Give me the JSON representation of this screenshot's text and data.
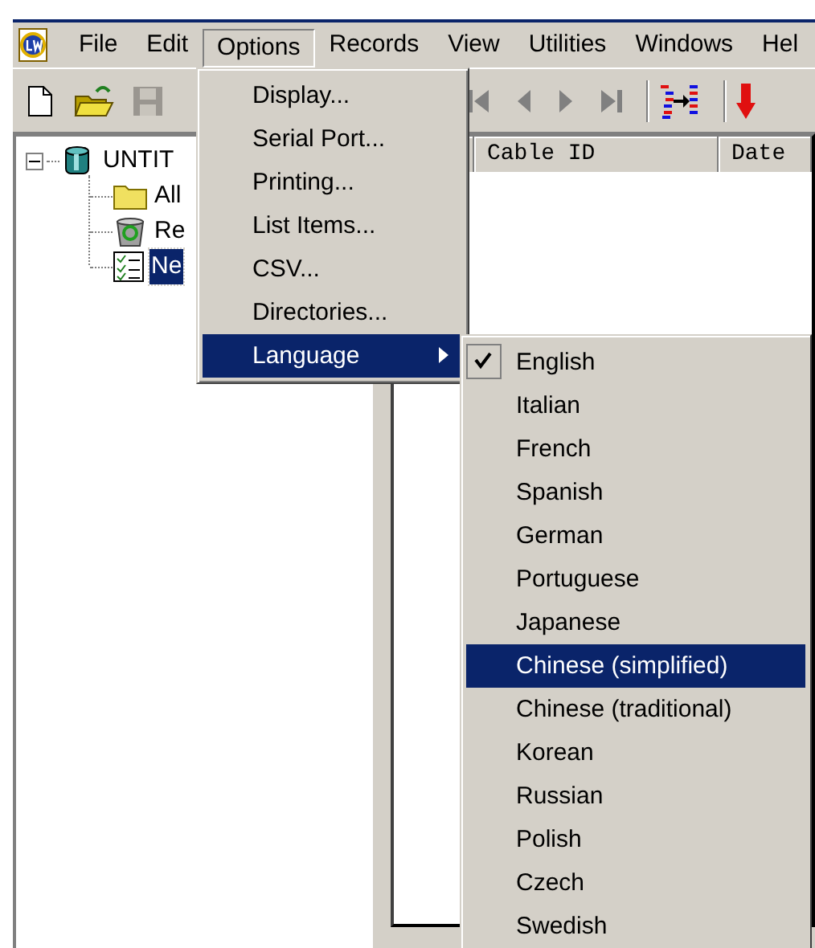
{
  "menubar": [
    {
      "label": "File",
      "selected": false
    },
    {
      "label": "Edit",
      "selected": false
    },
    {
      "label": "Options",
      "selected": true
    },
    {
      "label": "Records",
      "selected": false
    },
    {
      "label": "View",
      "selected": false
    },
    {
      "label": "Utilities",
      "selected": false
    },
    {
      "label": "Windows",
      "selected": false
    },
    {
      "label": "Hel",
      "selected": false
    }
  ],
  "tree": {
    "label": "UNTIT",
    "kind": "database",
    "expanded": true,
    "selected": false,
    "children": [
      {
        "label": "All",
        "kind": "folder",
        "selected": false
      },
      {
        "label": "Re",
        "kind": "bin",
        "selected": false
      },
      {
        "label": "Ne",
        "kind": "list",
        "selected": true
      }
    ]
  },
  "grid": {
    "columns": [
      "Cable ID",
      "Date"
    ]
  },
  "options_menu": {
    "items": [
      {
        "label": "Display...",
        "selected": false,
        "submenu": false
      },
      {
        "label": "Serial Port...",
        "selected": false,
        "submenu": false
      },
      {
        "label": "Printing...",
        "selected": false,
        "submenu": false
      },
      {
        "label": "List Items...",
        "selected": false,
        "submenu": false
      },
      {
        "label": "CSV...",
        "selected": false,
        "submenu": false
      },
      {
        "label": "Directories...",
        "selected": false,
        "submenu": false
      },
      {
        "label": "Language",
        "selected": true,
        "submenu": true
      }
    ]
  },
  "language_menu": {
    "items": [
      {
        "label": "English",
        "checked": true,
        "selected": false
      },
      {
        "label": "Italian",
        "checked": false,
        "selected": false
      },
      {
        "label": "French",
        "checked": false,
        "selected": false
      },
      {
        "label": "Spanish",
        "checked": false,
        "selected": false
      },
      {
        "label": "German",
        "checked": false,
        "selected": false
      },
      {
        "label": "Portuguese",
        "checked": false,
        "selected": false
      },
      {
        "label": "Japanese",
        "checked": false,
        "selected": false
      },
      {
        "label": "Chinese (simplified)",
        "checked": false,
        "selected": true
      },
      {
        "label": "Chinese (traditional)",
        "checked": false,
        "selected": false
      },
      {
        "label": "Korean",
        "checked": false,
        "selected": false
      },
      {
        "label": "Russian",
        "checked": false,
        "selected": false
      },
      {
        "label": "Polish",
        "checked": false,
        "selected": false
      },
      {
        "label": "Czech",
        "checked": false,
        "selected": false
      },
      {
        "label": "Swedish",
        "checked": false,
        "selected": false
      }
    ]
  }
}
